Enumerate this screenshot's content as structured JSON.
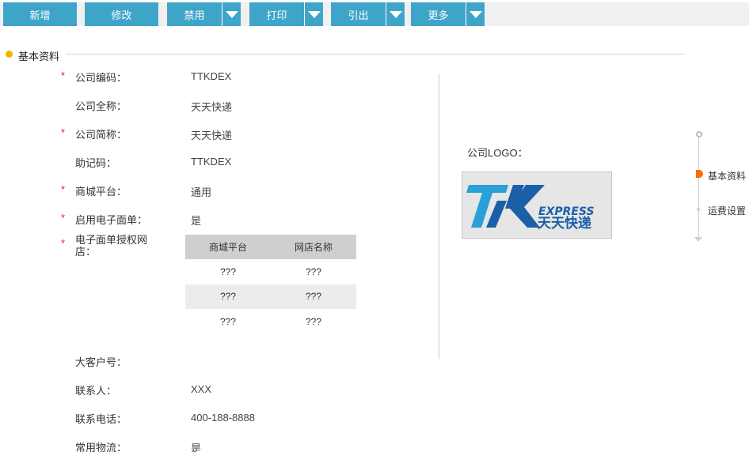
{
  "toolbar": {
    "buttons": [
      {
        "label": "新增",
        "has_caret": false
      },
      {
        "label": "修改",
        "has_caret": false
      },
      {
        "label": "禁用",
        "has_caret": true
      },
      {
        "label": "打印",
        "has_caret": true
      },
      {
        "label": "引出",
        "has_caret": true
      },
      {
        "label": "更多",
        "has_caret": true
      }
    ],
    "accent_color": "#3fa5c8"
  },
  "section": {
    "title": "基本资料"
  },
  "form": {
    "company_code": {
      "label": "公司编码：",
      "value": "TTKDEX",
      "required": true
    },
    "company_full_name": {
      "label": "公司全称：",
      "value": "天天快递",
      "required": false
    },
    "company_short_name": {
      "label": "公司简称：",
      "value": "天天快递",
      "required": true
    },
    "mnemonic_code": {
      "label": "助记码：",
      "value": "TTKDEX",
      "required": false
    },
    "mall_platform": {
      "label": "商城平台：",
      "value": "通用",
      "required": true
    },
    "enable_e_waybill": {
      "label": "启用电子面单：",
      "value": "是",
      "required": true
    },
    "e_waybill_authorized_shops": {
      "label": "电子面单授权网店：",
      "required": true
    },
    "key_account_no": {
      "label": "大客户号：",
      "value": ""
    },
    "contact_person": {
      "label": "联系人：",
      "value": "XXX"
    },
    "contact_phone": {
      "label": "联系电话：",
      "value": "400-188-8888"
    },
    "common_logistics": {
      "label": "常用物流：",
      "value": "是"
    }
  },
  "shop_table": {
    "headers": [
      "商城平台",
      "网店名称"
    ],
    "rows": [
      [
        "???",
        "???"
      ],
      [
        "???",
        "???"
      ],
      [
        "???",
        "???"
      ]
    ]
  },
  "logo": {
    "label": "公司LOGO：",
    "brand_text_en": "EXPRESS",
    "brand_text_cn": "天天快递",
    "brand_color": "#1a5fa8"
  },
  "right_nav": {
    "items": [
      {
        "label": "基本资料",
        "active": true
      },
      {
        "label": "运费设置",
        "active": false
      }
    ],
    "active_color": "#ff6a00"
  },
  "star": "*"
}
